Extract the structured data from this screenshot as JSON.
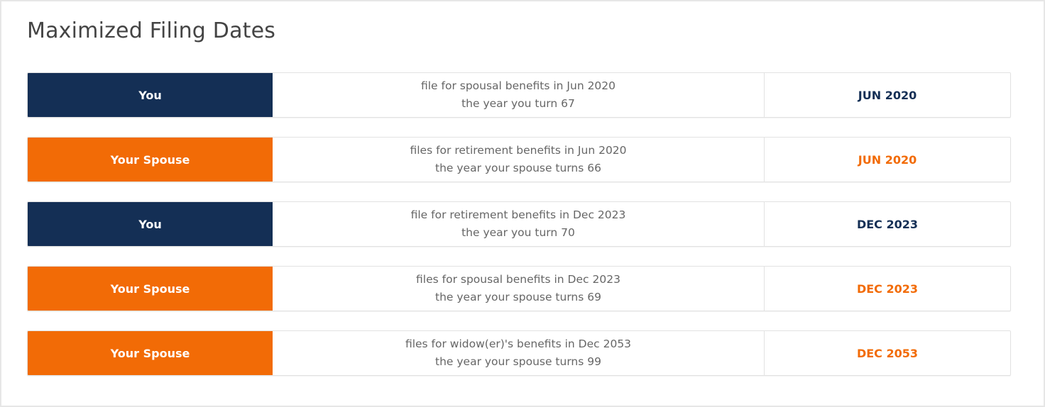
{
  "panel": {
    "title": "Maximized Filing Dates"
  },
  "colors": {
    "you": "#142f55",
    "spouse": "#f26b06",
    "description_text": "#666666",
    "title_text": "#444444"
  },
  "rows": [
    {
      "who": "You",
      "role": "you",
      "line1": "file for spousal benefits in Jun 2020",
      "line2": "the year you turn 67",
      "date": "JUN 2020"
    },
    {
      "who": "Your Spouse",
      "role": "spouse",
      "line1": "files for retirement benefits in Jun 2020",
      "line2": "the year your spouse turns 66",
      "date": "JUN 2020"
    },
    {
      "who": "You",
      "role": "you",
      "line1": "file for retirement benefits in Dec 2023",
      "line2": "the year you turn 70",
      "date": "DEC 2023"
    },
    {
      "who": "Your Spouse",
      "role": "spouse",
      "line1": "files for spousal benefits in Dec 2023",
      "line2": "the year your spouse turns 69",
      "date": "DEC 2023"
    },
    {
      "who": "Your Spouse",
      "role": "spouse",
      "line1": "files for widow(er)'s benefits in Dec 2053",
      "line2": "the year your spouse turns 99",
      "date": "DEC 2053"
    }
  ]
}
